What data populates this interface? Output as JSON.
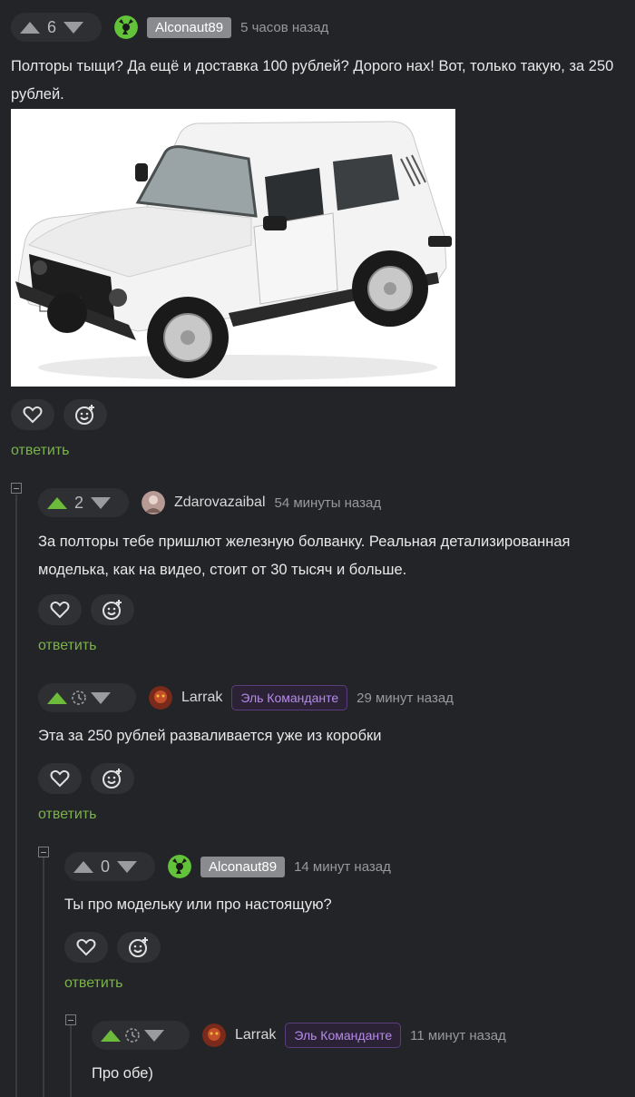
{
  "comments": [
    {
      "votes": "6",
      "author": "Alconaut89",
      "time": "5 часов назад",
      "text": "Полторы тыщи? Да ещё и доставка 100 рублей? Дорого нах! Вот, только такую, за 250 рублей.",
      "reply": "ответить"
    },
    {
      "votes": "2",
      "author": "Zdarovazaibal",
      "time": "54 минуты назад",
      "text": "За полторы тебе пришлют железную болванку. Реальная детализированная моделька, как на видео, стоит от 30 тысяч и больше.",
      "reply": "ответить"
    },
    {
      "author": "Larrak",
      "badge": "Эль Команданте",
      "time": "29 минут назад",
      "text": "Эта за 250 рублей разваливается уже из коробки",
      "reply": "ответить"
    },
    {
      "votes": "0",
      "author": "Alconaut89",
      "time": "14 минут назад",
      "text": "Ты про модельку или про настоящую?",
      "reply": "ответить"
    },
    {
      "author": "Larrak",
      "badge": "Эль Команданте",
      "time": "11 минут назад",
      "text": "Про обе)"
    }
  ],
  "colors": {
    "background": "#232427",
    "accent_green": "#6dbb3a",
    "badge_purple": "#b58be8"
  },
  "icons": [
    "upvote-icon",
    "downvote-icon",
    "heart-icon",
    "smiley-plus-icon",
    "clock-icon",
    "collapse-icon"
  ]
}
